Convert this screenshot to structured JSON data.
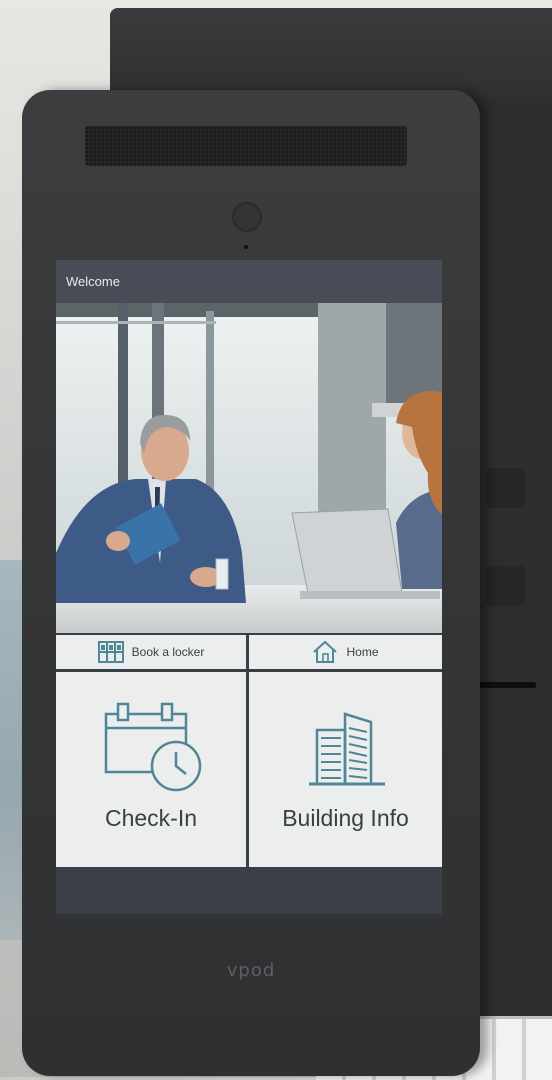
{
  "screen": {
    "welcome_label": "Welcome",
    "photo_icon": "office-meeting-photo",
    "small_tiles": [
      {
        "label": "Book a locker",
        "icon": "locker-icon"
      },
      {
        "label": "Home",
        "icon": "home-icon"
      }
    ],
    "big_tiles": [
      {
        "label": "Check-In",
        "icon": "calendar-clock-icon"
      },
      {
        "label": "Building Info",
        "icon": "building-icon"
      }
    ]
  },
  "device": {
    "brand": "vpod"
  },
  "colors": {
    "accent": "#4f8797",
    "tile_bg": "#eceeed",
    "header_bg": "#474c57",
    "device_body": "#343537"
  }
}
